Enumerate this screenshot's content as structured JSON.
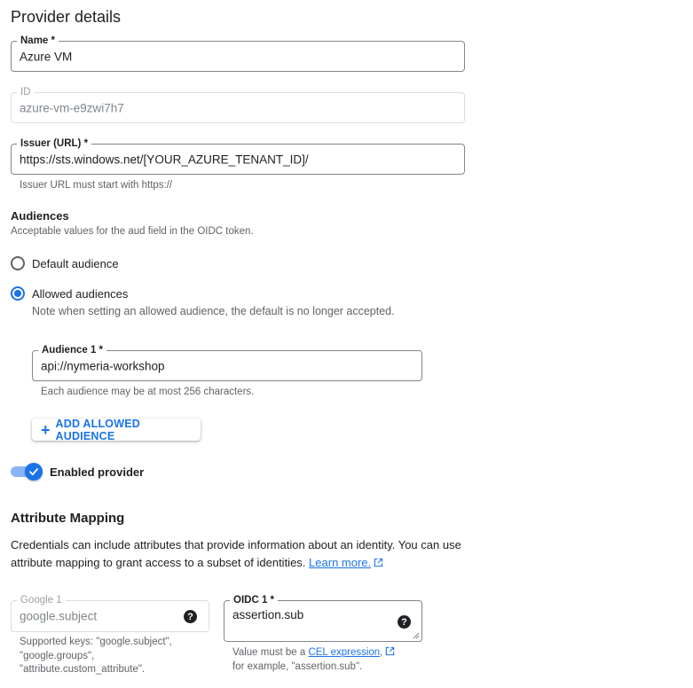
{
  "page": {
    "title": "Provider details"
  },
  "name_field": {
    "label": "Name *",
    "value": "Azure VM"
  },
  "id_field": {
    "label": "ID",
    "value": "azure-vm-e9zwi7h7"
  },
  "issuer_field": {
    "label": "Issuer (URL) *",
    "value": "https://sts.windows.net/[YOUR_AZURE_TENANT_ID]/",
    "hint": "Issuer URL must start with https://"
  },
  "audiences": {
    "title": "Audiences",
    "subtitle": "Acceptable values for the aud field in the OIDC token.",
    "options": [
      {
        "label": "Default audience",
        "checked": false
      },
      {
        "label": "Allowed audiences",
        "checked": true,
        "note": "Note when setting an allowed audience, the default is no longer accepted."
      }
    ],
    "audience_field": {
      "label": "Audience 1 *",
      "value": "api://nymeria-workshop",
      "hint": "Each audience may be at most 256 characters."
    },
    "add_button_label": "ADD ALLOWED AUDIENCE"
  },
  "provider_toggle": {
    "label": "Enabled provider",
    "enabled": true
  },
  "attribute_mapping": {
    "title": "Attribute Mapping",
    "description_line1": "Credentials can include attributes that provide information about an identity. You can use",
    "description_line2": "attribute mapping to grant access to a subset of identities.",
    "learn_more": "Learn more.",
    "google_field": {
      "label": "Google 1",
      "value": "google.subject",
      "hint_line1": "Supported keys: \"google.subject\",",
      "hint_line2": "\"google.groups\",",
      "hint_line3": "\"attribute.custom_attribute\"."
    },
    "oidc_field": {
      "label": "OIDC 1 *",
      "value": "assertion.sub",
      "hint_prefix": "Value must be a ",
      "hint_link": "CEL expression",
      "hint_suffix": ",",
      "hint_line2": "for example, \"assertion.sub\"."
    }
  },
  "icons": {
    "help": "help-icon",
    "external_link": "external-link-icon",
    "plus": "plus-icon",
    "check": "check-icon"
  },
  "colors": {
    "accent": "#1a73e8",
    "toggle_track": "#8ab4f8",
    "text": "#202124",
    "muted": "#5f6368"
  }
}
